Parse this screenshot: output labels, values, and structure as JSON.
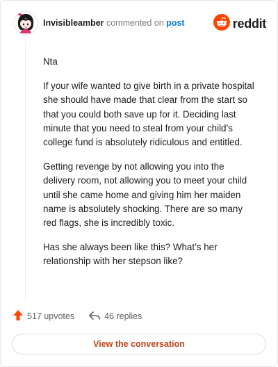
{
  "header": {
    "username": "Invisibleamber",
    "action_text": "commented on",
    "post_link": "post",
    "logo_text": "reddit"
  },
  "comment": {
    "paragraphs": [
      "Nta",
      "If your wife wanted to give birth in a private hospital she should have made that clear from the start so that you could both save up for it. Deciding last minute that you need to steal from your child’s college fund is absolutely ridiculous and entitled.",
      "Getting revenge by not allowing you into the delivery room, not allowing you to meet your child until she came home and giving him her maiden name is absolutely shocking. There are so many red flags, she is incredibly toxic.",
      "Has she always been like this? What’s her relationship with her stepson like?"
    ]
  },
  "actions": {
    "upvotes": "517 upvotes",
    "replies": "46 replies"
  },
  "footer": {
    "view_button": "View the conversation"
  },
  "colors": {
    "accent_orange": "#ff4500",
    "link_blue": "#0079d3",
    "button_text": "#c1441b"
  }
}
